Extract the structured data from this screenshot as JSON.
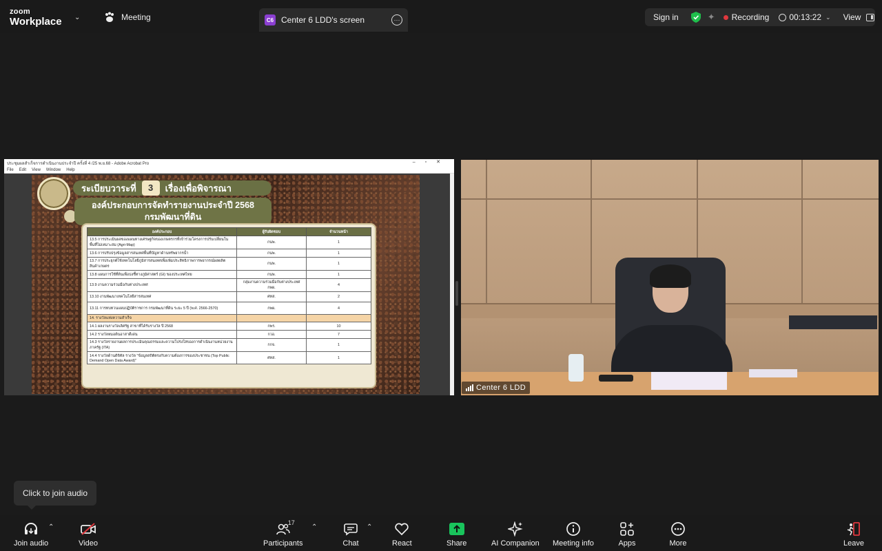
{
  "topbar": {
    "logo_line1": "zoom",
    "logo_line2": "Workplace",
    "meeting_label": "Meeting",
    "share_tab": {
      "badge": "C6",
      "title": "Center 6 LDD's screen"
    },
    "sign_in": "Sign in",
    "recording_label": "Recording",
    "timer": "00:13:22",
    "view_label": "View"
  },
  "acrobat": {
    "window_title": "ประชุมผลสำเร็จการดำเนินงานประจำปี ครั้งที่ 4 /25 พ.ย.68 - Adobe Acrobat Pro",
    "menu": [
      "File",
      "Edit",
      "View",
      "Window",
      "Help"
    ]
  },
  "slide": {
    "agenda_prefix": "ระเบียบวาระที่",
    "agenda_number": "3",
    "agenda_suffix": "เรื่องเพื่อพิจารณา",
    "title_line1": "องค์ประกอบการจัดทำรายงานประจำปี 2568",
    "title_line2": "กรมพัฒนาที่ดิน",
    "headers": [
      "องค์ประกอบ",
      "ผู้รับผิดชอบ",
      "จำนวนหน้า"
    ],
    "rows": [
      [
        "13.5 การประเมินผลของแผนทางเศรษฐกิจของเกษตรกรที่เข้าร่วมโครงการปรับเปลี่ยนในพื้นที่ไม่เหมาะสม (Agri-Map)",
        "กนพ.",
        "1",
        false
      ],
      [
        "13.6 การปรับปรุงข้อมูลสารสนเทศพื้นที่ปัญหาด้านทรัพยากรน้ำ",
        "กนพ.",
        "1",
        false
      ],
      [
        "13.7 การประยุกต์ใช้เทคโนโลยีภูมิสารสนเทศเพื่อเพิ่มประสิทธิภาพการพยากรณ์ผลผลิตสินค้าเกษตร",
        "กนพ.",
        "1",
        false
      ],
      [
        "13.8 แผนการใช้ที่ดินเพื่อบ่งชี้ทางภูมิศาสตร์ (GI) ของประเทศไทย",
        "กนพ.",
        "1",
        false
      ],
      [
        "13.9 งานความร่วมมือกับต่างประเทศ",
        "กลุ่มงานความร่วมมือกับต่างประเทศ กพผ.",
        "4",
        false
      ],
      [
        "13.10 งานพัฒนาเทคโนโลยีสารสนเทศ",
        "ศทส.",
        "2",
        false
      ],
      [
        "13.11 การทบทวนแผนปฏิบัติราชการ กรมพัฒนาที่ดิน ระยะ 5 ปี (พ.ศ. 2566-2570)",
        "กพผ.",
        "4",
        false
      ],
      [
        "14. รางวัลแห่งความสำเร็จ",
        "",
        "",
        true
      ],
      [
        "14.1 ผลงานรางวัลเลิศรัฐ สาขาที่ได้รับรางวัล ปี 2568",
        "กพร.",
        "10",
        false
      ],
      [
        "14.2 รางวัลหมอดินอาสาดีเด่น",
        "กวอ.",
        "7",
        false
      ],
      [
        "14.3 รางวัลรายงานผลการประเมินคุณธรรมและความโปร่งใสของการดำเนินงานหน่วยงานภาครัฐ (ITA)",
        "กกจ.",
        "1",
        false
      ],
      [
        "14.4 รางวัลด้านดิจิทัล รางวัล \"ข้อมูลสถิติตรงกับความต้องการของประชาชน (Top Public Demand Open Data Award)\"",
        "ศทส.",
        "1",
        false
      ]
    ]
  },
  "video": {
    "participant_name": "Center 6 LDD"
  },
  "tooltip": {
    "text": "Click to join audio"
  },
  "toolbar": {
    "join_audio": "Join audio",
    "video": "Video",
    "participants": "Participants",
    "participants_count": "17",
    "chat": "Chat",
    "react": "React",
    "share": "Share",
    "ai_companion": "AI Companion",
    "meeting_info": "Meeting info",
    "apps": "Apps",
    "more": "More",
    "leave": "Leave"
  },
  "colors": {
    "background": "#1a1a1a",
    "recording_red": "#e0383e",
    "share_green": "#19c45c",
    "leave_red": "#e0383e",
    "shield_green": "#1fbf4c"
  }
}
